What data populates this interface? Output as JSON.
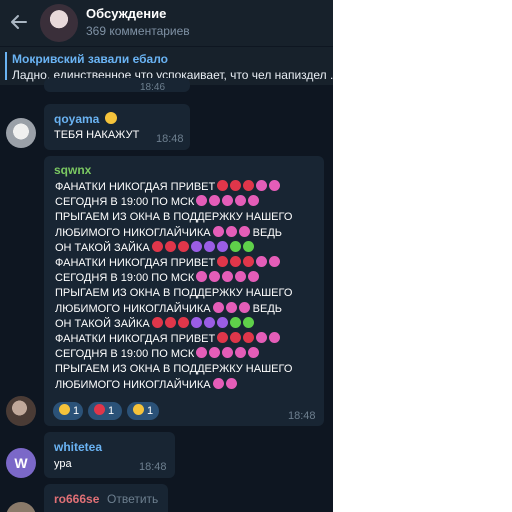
{
  "header": {
    "title": "Обсуждение",
    "subtitle": "369 комментариев"
  },
  "pinned": {
    "name": "Мокривский завали ебало",
    "text": "Ладно, единственное что успокаивает, что чел напиздел ..."
  },
  "ghost_time": "18:46",
  "messages": [
    {
      "name": "qoyama",
      "name_color": "#6ab3f3",
      "emoji": "laughing-face-emoji",
      "text": "ТЕБЯ НАКАЖУТ",
      "time": "18:48"
    },
    {
      "name": "sqwnx",
      "name_color": "#7bc862",
      "lines": [
        {
          "text": "ФАНАТКИ НИКОГДАЯ ПРИВЕТ",
          "emoji": [
            "red",
            "red",
            "red",
            "pink",
            "pink"
          ]
        },
        {
          "text": "СЕГОДНЯ В 19:00 ПО МСК",
          "emoji": [
            "pink",
            "pink",
            "pink",
            "pink",
            "pink"
          ]
        },
        {
          "text": "ПРЫГАЕМ ИЗ ОКНА В ПОДДЕРЖКУ НАШЕГО",
          "emoji": []
        },
        {
          "text": "ЛЮБИМОГО НИКОГЛАЙЧИКА",
          "emoji": [
            "pink",
            "pink",
            "pink"
          ],
          "suffix": "ВЕДЬ"
        },
        {
          "text": "ОН ТАКОЙ ЗАЙКА",
          "emoji": [
            "red",
            "red",
            "red",
            "purple",
            "purple",
            "purple",
            "green",
            "green"
          ]
        },
        {
          "text": "ФАНАТКИ НИКОГДАЯ ПРИВЕТ",
          "emoji": [
            "red",
            "red",
            "red",
            "pink",
            "pink"
          ]
        },
        {
          "text": "СЕГОДНЯ В 19:00 ПО МСК",
          "emoji": [
            "pink",
            "pink",
            "pink",
            "pink",
            "pink"
          ]
        },
        {
          "text": "ПРЫГАЕМ ИЗ ОКНА В ПОДДЕРЖКУ НАШЕГО",
          "emoji": []
        },
        {
          "text": "ЛЮБИМОГО НИКОГЛАЙЧИКА",
          "emoji": [
            "pink",
            "pink",
            "pink"
          ],
          "suffix": "ВЕДЬ"
        },
        {
          "text": "ОН ТАКОЙ ЗАЙКА",
          "emoji": [
            "red",
            "red",
            "red",
            "purple",
            "purple",
            "purple",
            "green",
            "green"
          ]
        },
        {
          "text": "ФАНАТКИ НИКОГДАЯ ПРИВЕТ",
          "emoji": [
            "red",
            "red",
            "red",
            "pink",
            "pink"
          ]
        },
        {
          "text": "СЕГОДНЯ В 19:00 ПО МСК",
          "emoji": [
            "pink",
            "pink",
            "pink",
            "pink",
            "pink"
          ]
        },
        {
          "text": "ПРЫГАЕМ ИЗ ОКНА В ПОДДЕРЖКУ НАШЕГО",
          "emoji": []
        },
        {
          "text": "ЛЮБИМОГО НИКОГЛАЙЧИКА",
          "emoji": [
            "pink",
            "pink"
          ]
        }
      ],
      "reactions": [
        {
          "icon": "thumbs-up-emoji",
          "count": "1"
        },
        {
          "icon": "heart-emoji",
          "count": "1"
        },
        {
          "icon": "thinking-face-emoji",
          "count": "1"
        }
      ],
      "time": "18:48"
    },
    {
      "name": "whitetea",
      "name_color": "#6ab3f3",
      "avatar_letter": "W",
      "text": "ура",
      "time": "18:48"
    },
    {
      "name": "ro666se",
      "name_color": "#e17076",
      "reply_label": "Ответить"
    }
  ],
  "colors": {
    "background": "#0e1621",
    "header": "#17212b",
    "bubble": "#182533",
    "accent": "#6ab3f3",
    "red": "#e0364a",
    "pink": "#e45db8",
    "purple": "#9b5de5",
    "green": "#5fd04a"
  }
}
